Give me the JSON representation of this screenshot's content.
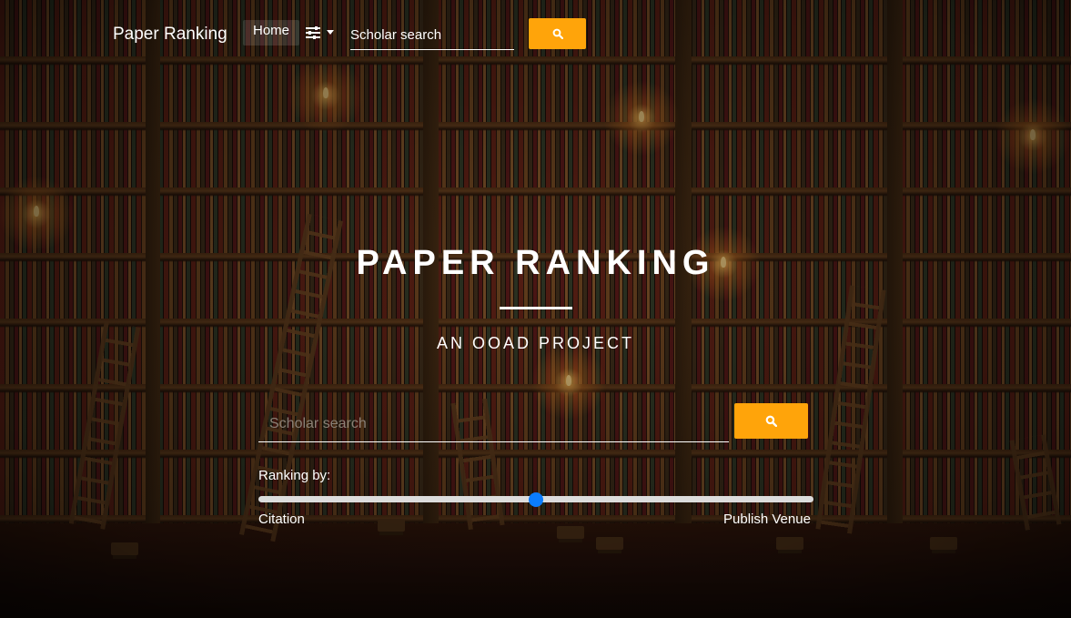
{
  "navbar": {
    "brand": "Paper Ranking",
    "home_label": "Home",
    "search_placeholder": "Scholar search"
  },
  "icons": {
    "filter_toggle": "sliders-icon",
    "dropdown": "caret-down-icon",
    "search": "search-icon"
  },
  "hero": {
    "title": "PAPER RANKING",
    "subtitle": "AN OOAD PROJECT"
  },
  "search": {
    "placeholder": "Scholar search"
  },
  "ranking": {
    "label": "Ranking by:",
    "min_label": "Citation",
    "max_label": "Publish Venue",
    "value_fraction": 0.5
  },
  "colors": {
    "accent": "#ffa40a",
    "slider_thumb": "#0b7cff"
  }
}
